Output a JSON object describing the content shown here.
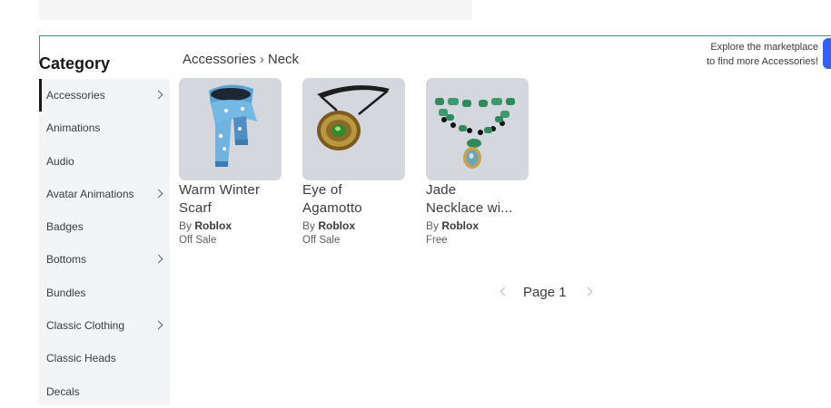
{
  "sidebar": {
    "title": "Category",
    "items": [
      {
        "label": "Accessories",
        "chevron": true,
        "active": true
      },
      {
        "label": "Animations",
        "chevron": false
      },
      {
        "label": "Audio",
        "chevron": false
      },
      {
        "label": "Avatar Animations",
        "chevron": true
      },
      {
        "label": "Badges",
        "chevron": false
      },
      {
        "label": "Bottoms",
        "chevron": true
      },
      {
        "label": "Bundles",
        "chevron": false
      },
      {
        "label": "Classic Clothing",
        "chevron": true
      },
      {
        "label": "Classic Heads",
        "chevron": false
      },
      {
        "label": "Decals",
        "chevron": false
      }
    ]
  },
  "breadcrumb": {
    "parent": "Accessories",
    "separator": "›",
    "current": "Neck"
  },
  "explore": {
    "line1": "Explore the marketplace",
    "line2": "to find more Accessories!"
  },
  "items": [
    {
      "name_line1": "Warm Winter",
      "name_line2": "Scarf",
      "by": "By",
      "creator": "Roblox",
      "price": "Off Sale",
      "icon": "scarf-icon"
    },
    {
      "name_line1": "Eye of",
      "name_line2": "Agamotto",
      "by": "By",
      "creator": "Roblox",
      "price": "Off Sale",
      "icon": "amulet-icon"
    },
    {
      "name_line1": "Jade",
      "name_line2": "Necklace wi...",
      "by": "By",
      "creator": "Roblox",
      "price": "Free",
      "icon": "necklace-icon"
    }
  ],
  "pagination": {
    "label": "Page 1"
  },
  "colors": {
    "accent": "#335fff",
    "divider": "#3b8f8f",
    "sidebar_bg": "#f2f4f5",
    "thumb_bg": "#d4d7dd"
  }
}
